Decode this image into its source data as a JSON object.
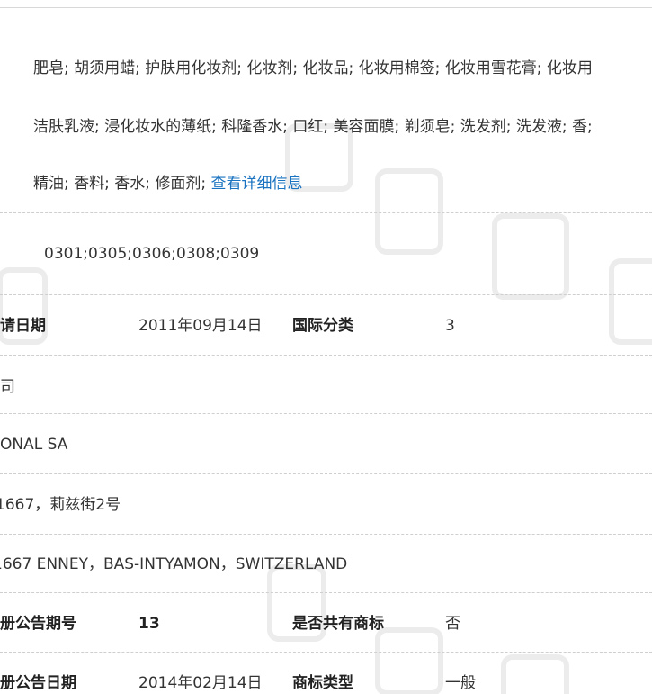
{
  "goods_services": {
    "line1": "肥皂; 胡须用蜡; 护肤用化妆剂; 化妆剂; 化妆品; 化妆用棉签; 化妆用雪花膏; 化妆用",
    "line2": "洁肤乳液; 浸化妆水的薄纸; 科隆香水; 口红; 美容面膜; 剃须皂; 洗发剂; 洗发液; 香;",
    "line3": "精油; 香料; 香水; 修面剂;",
    "detail_link": "查看详细信息"
  },
  "similar_groups": "0301;0305;0306;0308;0309",
  "application_row": {
    "date_label": "申请日期",
    "date_value": "2011年09月14日",
    "class_label": "国际分类",
    "class_value": "3"
  },
  "applicant": {
    "name_cn": "司",
    "name_en": "IONAL SA",
    "address_cn": "1667，莉兹街2号",
    "address_en": "1667 ENNEY，BAS-INTYAMON，SWITZERLAND"
  },
  "registration_issue_row": {
    "issue_label": "注册公告期号",
    "issue_value": "13",
    "shared_label": "是否共有商标",
    "shared_value": "否"
  },
  "registration_date_row": {
    "date_label": "注册公告日期",
    "date_value": "2014年02月14日",
    "type_label": "商标类型",
    "type_value": "一般"
  }
}
